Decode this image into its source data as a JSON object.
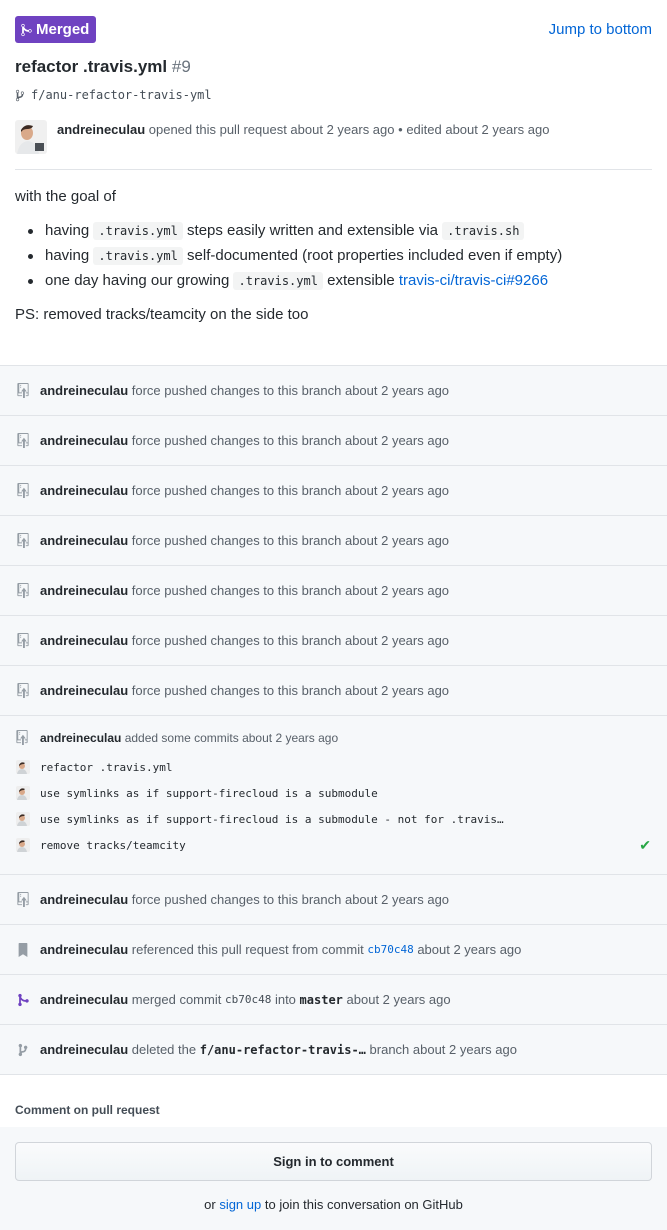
{
  "header": {
    "badge": "Merged",
    "jump_link": "Jump to bottom",
    "title": "refactor .travis.yml",
    "number": "#9",
    "branch": "f/anu-refactor-travis-yml"
  },
  "opening": {
    "author": "andreineculau",
    "action": "opened this pull request about 2 years ago",
    "sep": "•",
    "edited": "edited about 2 years ago"
  },
  "description": {
    "intro": "with the goal of",
    "bullets": [
      {
        "t1": "having",
        "c1": ".travis.yml",
        "t2": "steps easily written and extensible via",
        "c2": ".travis.sh"
      },
      {
        "t1": "having",
        "c1": ".travis.yml",
        "t2": "self-documented (root properties included even if empty)"
      },
      {
        "t1": "one day having our growing",
        "c1": ".travis.yml",
        "t2": "extensible",
        "link": "travis-ci/travis-ci#9266"
      }
    ],
    "ps": "PS: removed tracks/teamcity on the side too"
  },
  "timeline": {
    "force_push": {
      "author": "andreineculau",
      "text": "force pushed changes to this branch about 2 years ago"
    },
    "commits_event": {
      "author": "andreineculau",
      "text": "added some commits about 2 years ago",
      "commits": [
        "refactor .travis.yml",
        "use symlinks as if support-firecloud is a submodule",
        "use symlinks as if support-firecloud is a submodule - not for .travis…",
        "remove tracks/teamcity"
      ],
      "check": "✔"
    },
    "reference": {
      "author": "andreineculau",
      "text": "referenced this pull request from commit",
      "sha": "cb70c48",
      "time": "about 2 years ago"
    },
    "merge": {
      "author": "andreineculau",
      "text": "merged commit",
      "sha": "cb70c48",
      "into": "into",
      "target": "master",
      "time": "about 2 years ago"
    },
    "delete": {
      "author": "andreineculau",
      "text": "deleted the",
      "branch": "f/anu-refactor-travis-…",
      "tail": "branch about 2 years ago"
    }
  },
  "footer": {
    "comment_label": "Comment on pull request",
    "signin": "Sign in to comment",
    "or": "or",
    "signup": "sign up",
    "rest": "to join this conversation on GitHub"
  },
  "colors": {
    "merged": "#6f42c1",
    "link": "#0366d6",
    "check": "#28a745"
  }
}
